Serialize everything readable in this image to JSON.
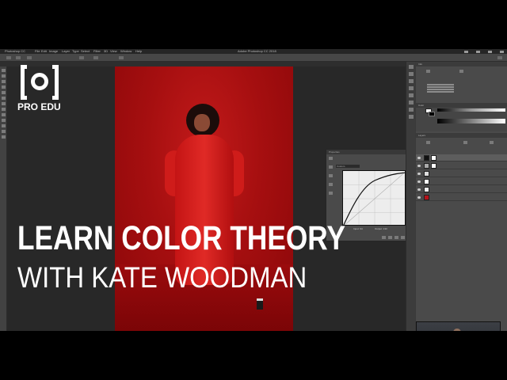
{
  "photoshop": {
    "app_name": "Photoshop CC",
    "menu": {
      "file": "File",
      "edit": "Edit",
      "image": "Image",
      "layer": "Layer",
      "type": "Type",
      "select": "Select",
      "filter": "Filter",
      "three_d": "3D",
      "view": "View",
      "window": "Window",
      "help": "Help"
    },
    "window_title": "Adobe Photoshop CC 2018",
    "tab_title": "",
    "properties_title": "Properties",
    "properties_preset": "Custom",
    "input_label": "Input: 94",
    "output_label": "Output: 133"
  },
  "overlay": {
    "brand": "PRO EDU",
    "headline": "LEARN COLOR THEORY",
    "subheadline": "WITH KATE WOODMAN"
  },
  "panels": {
    "color_label": "Color",
    "layers_label": "Layers",
    "info_title": "Info",
    "info_values": [
      "",
      ""
    ],
    "layer_names": [
      "",
      "",
      "",
      "",
      "",
      ""
    ]
  },
  "colors": {
    "backdrop_red": "#a60f10",
    "coat_red": "#d81f1f",
    "curve_line": "#111111"
  },
  "icons": {
    "toolbar": [
      "move-icon",
      "marquee-icon",
      "lasso-icon",
      "crop-icon",
      "eyedropper-icon",
      "brush-icon",
      "clone-icon",
      "eraser-icon",
      "gradient-icon",
      "pen-icon",
      "type-icon",
      "hand-icon",
      "zoom-icon"
    ],
    "properties": [
      "curves-icon",
      "eyedropper-icon",
      "sample-icon",
      "pencil-icon",
      "smooth-icon"
    ]
  }
}
